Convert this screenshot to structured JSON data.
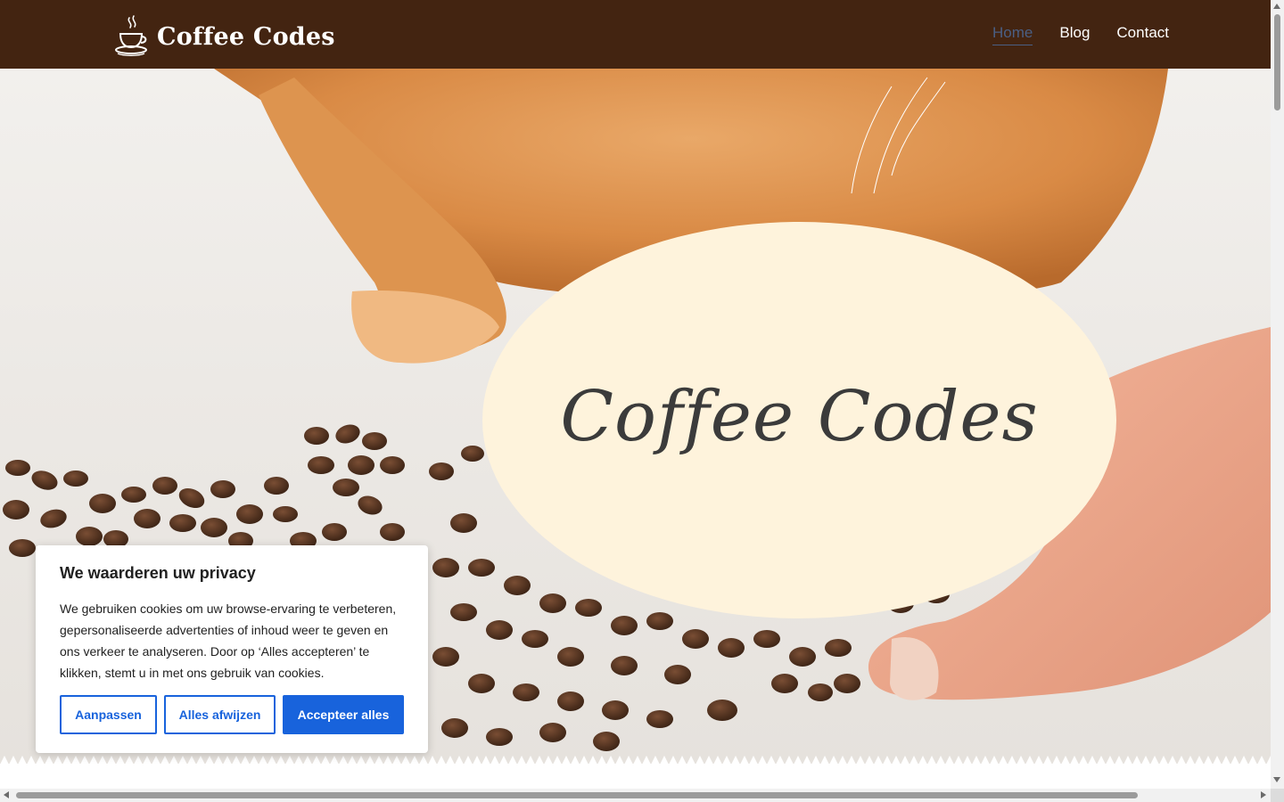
{
  "header": {
    "logo_text": "Coffee Codes",
    "logo_icon": "coffee-cup-icon",
    "background_color": "#432411",
    "nav": [
      {
        "label": "Home",
        "active": true
      },
      {
        "label": "Blog",
        "active": false
      },
      {
        "label": "Contact",
        "active": false
      }
    ]
  },
  "hero": {
    "title": "Coffee Codes",
    "oval_color": "#fef3dc",
    "image": "orange-cat-and-coffee-beans-photo"
  },
  "cookie_banner": {
    "title": "We waarderen uw privacy",
    "text": "We gebruiken cookies om uw browse-ervaring te verbeteren, gepersonaliseerde advertenties of inhoud weer te geven en ons verkeer te analyseren. Door op ‘Alles accepteren’ te klikken, stemt u in met ons gebruik van cookies.",
    "buttons": {
      "customize": "Aanpassen",
      "reject": "Alles afwijzen",
      "accept": "Accepteer alles"
    },
    "accent_color": "#1863dc"
  }
}
